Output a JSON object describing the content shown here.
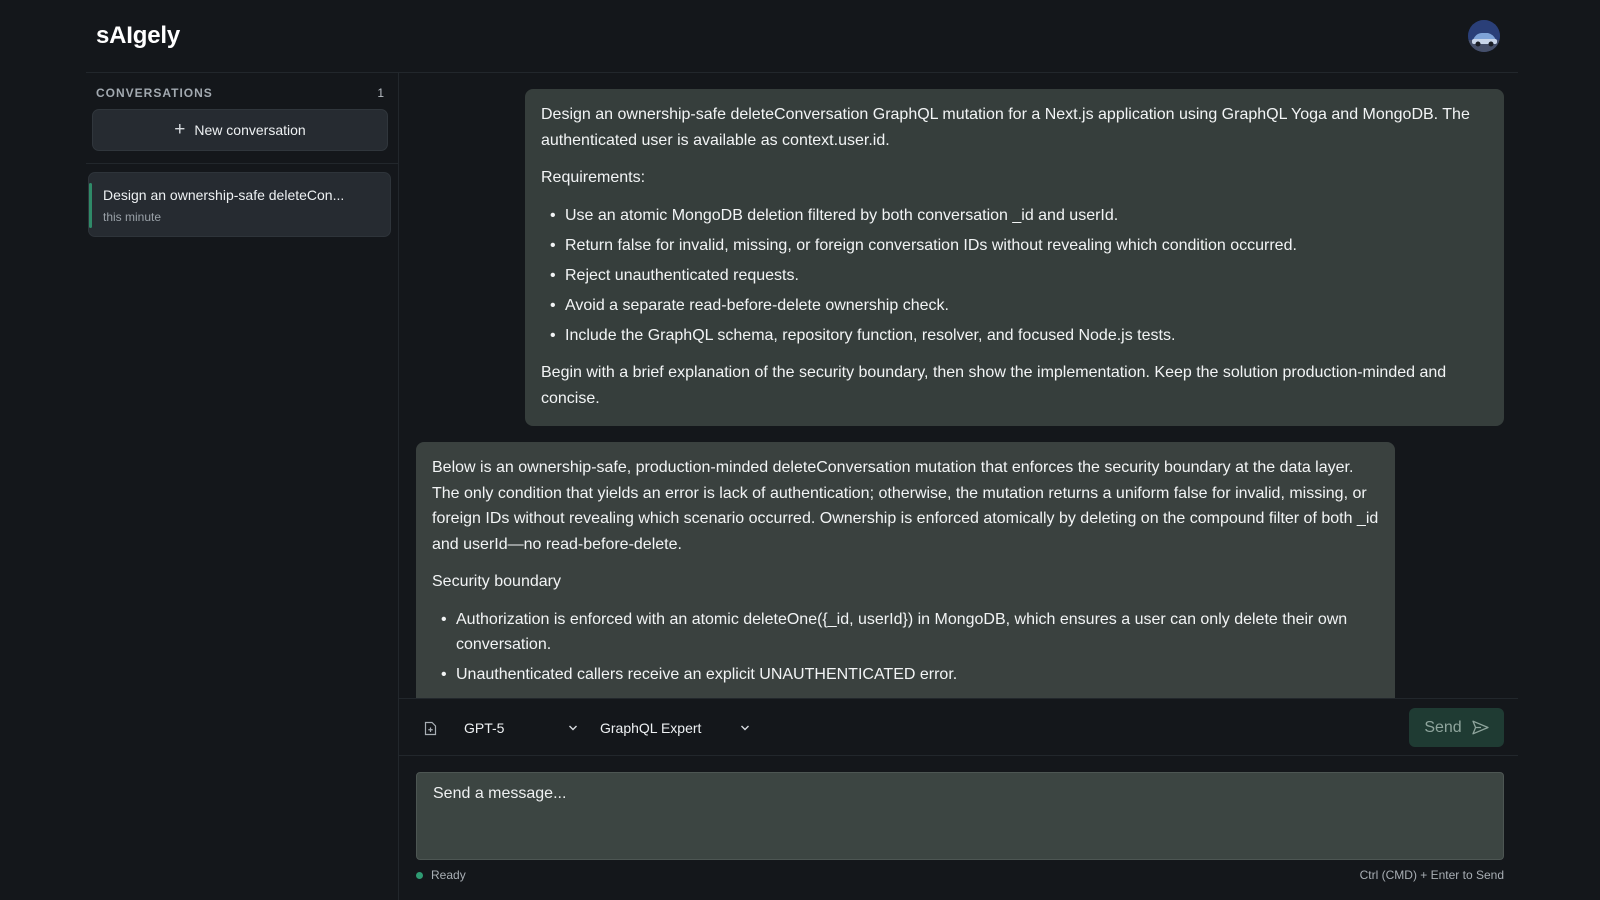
{
  "app": {
    "brand": "sAIgely"
  },
  "sidebar": {
    "heading": "CONVERSATIONS",
    "count": "1",
    "new_button_label": "New conversation",
    "conversations": [
      {
        "title": "Design an ownership-safe deleteCon...",
        "time": "this minute",
        "active": true
      }
    ]
  },
  "messages": {
    "user": {
      "intro": "Design an ownership-safe deleteConversation GraphQL mutation for a Next.js application using GraphQL Yoga and MongoDB. The authenticated user is available as context.user.id.",
      "requirements_heading": "Requirements:",
      "requirements": [
        "Use an atomic MongoDB deletion filtered by both conversation _id and userId.",
        "Return false for invalid, missing, or foreign conversation IDs without revealing which condition occurred.",
        "Reject unauthenticated requests.",
        "Avoid a separate read-before-delete ownership check.",
        "Include the GraphQL schema, repository function, resolver, and focused Node.js tests."
      ],
      "closing": "Begin with a brief explanation of the security boundary, then show the implementation. Keep the solution production-minded and concise."
    },
    "assistant": {
      "intro": "Below is an ownership-safe, production-minded deleteConversation mutation that enforces the security boundary at the data layer. The only condition that yields an error is lack of authentication; otherwise, the mutation returns a uniform false for invalid, missing, or foreign IDs without revealing which scenario occurred. Ownership is enforced atomically by deleting on the compound filter of both _id and userId—no read-before-delete.",
      "section_heading": "Security boundary",
      "bullets": [
        "Authorization is enforced with an atomic deleteOne({_id, userId}) in MongoDB, which ensures a user can only delete their own conversation.",
        "Unauthenticated callers receive an explicit UNAUTHENTICATED error."
      ]
    }
  },
  "toolbar": {
    "model": "GPT-5",
    "persona": "GraphQL Expert",
    "send_label": "Send"
  },
  "composer": {
    "placeholder": "Send a message..."
  },
  "status": {
    "text": "Ready",
    "hint": "Ctrl (CMD) + Enter to Send"
  },
  "colors": {
    "accent": "#2f8a68",
    "status_ready": "#2f9b73",
    "send_bg": "#1f3b33"
  }
}
